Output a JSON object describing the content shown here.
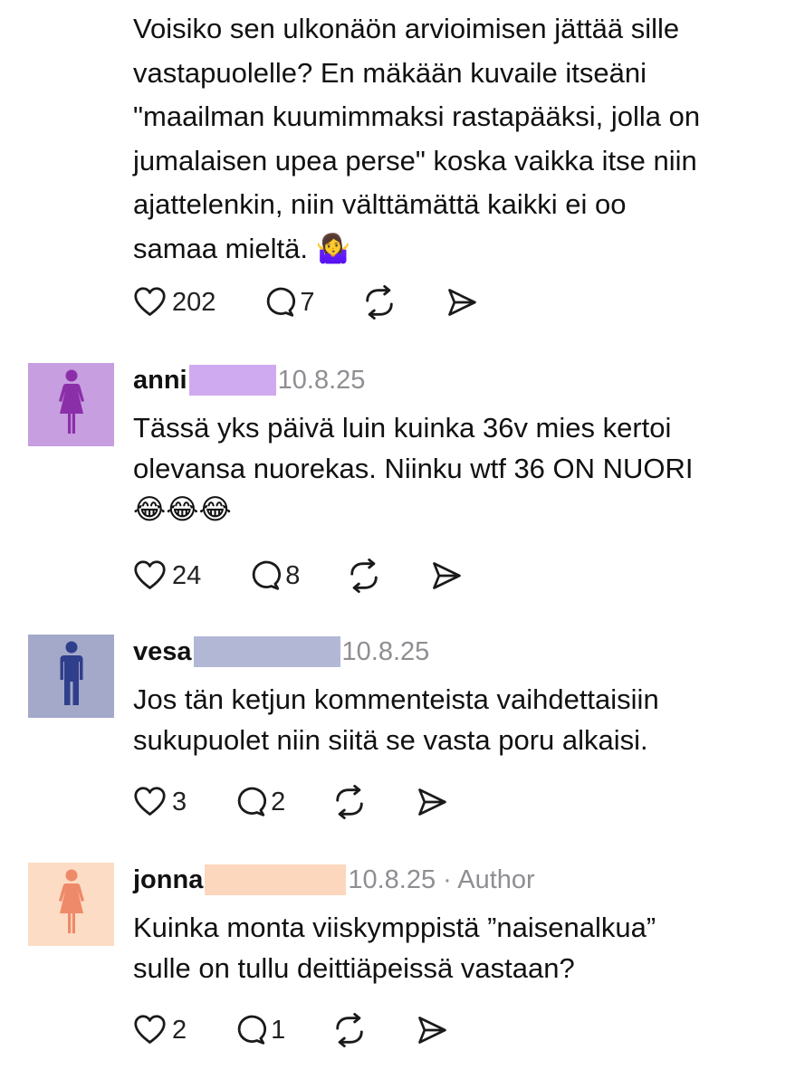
{
  "thread": {
    "top_comment": {
      "text_lines": [
        "Voisiko sen ulkonäön arvioimisen jättää sille",
        "vastapuolelle? En mäkään kuvaile itseäni",
        "\"maailman kuumimmaksi rastapääksi, jolla on",
        "jumalaisen upea perse\" koska vaikka itse niin",
        "ajattelenkin, niin välttämättä kaikki ei oo",
        "samaa mieltä. 🤷‍♀️"
      ],
      "likes": "202",
      "replies": "7"
    },
    "comments": [
      {
        "username": "anni",
        "date": "10.8.25",
        "text_lines": [
          "Tässä yks päivä luin kuinka 36v mies kertoi",
          "olevansa nuorekas. Niinku wtf 36 ON NUORI",
          "😂😂😂"
        ],
        "likes": "24",
        "replies": "8"
      },
      {
        "username": "vesa",
        "date": "10.8.25",
        "text_lines": [
          "Jos tän ketjun kommenteista vaihdettaisiin",
          "sukupuolet niin siitä se vasta poru alkaisi."
        ],
        "likes": "3",
        "replies": "2"
      },
      {
        "username": "jonna",
        "date": "10.8.25 · Author",
        "text_lines": [
          "Kuinka monta viiskymppistä ”naisenalkua”",
          "sulle on tullu deittiäpeissä vastaan?"
        ],
        "likes": "2",
        "replies": "1"
      }
    ]
  },
  "icons": {
    "like": "heart-icon",
    "reply": "comment-bubble-icon",
    "repost": "repost-icon",
    "share": "send-icon",
    "avatar_female": "female-figure-icon",
    "avatar_male": "male-figure-icon"
  },
  "colors": {
    "anni_avatar_bg": "#c79ee0",
    "anni_figure": "#8b2fa8",
    "anni_redaction": "#d0aaf0",
    "vesa_avatar_bg": "#a4a9c9",
    "vesa_figure": "#2f3f8c",
    "vesa_redaction": "#b3b7d6",
    "jonna_avatar_bg": "#fcdcc4",
    "jonna_figure": "#ee8a6a",
    "jonna_redaction": "#fcd6bd",
    "date_gray": "#8e8e93"
  }
}
